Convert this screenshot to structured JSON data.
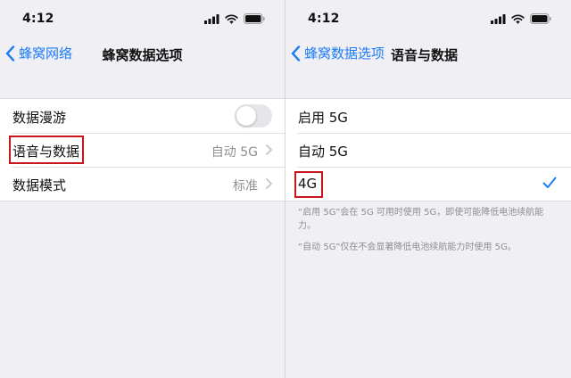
{
  "status": {
    "time": "4:12"
  },
  "left": {
    "back_label": "蜂窝网络",
    "title": "蜂窝数据选项",
    "rows": [
      {
        "label": "数据漫游",
        "toggle_on": false
      },
      {
        "label": "语音与数据",
        "value": "自动 5G"
      },
      {
        "label": "数据模式",
        "value": "标准"
      }
    ]
  },
  "right": {
    "back_label": "蜂窝数据选项",
    "title": "语音与数据",
    "options": [
      {
        "label": "启用 5G",
        "selected": false
      },
      {
        "label": "自动 5G",
        "selected": false
      },
      {
        "label": "4G",
        "selected": true
      }
    ],
    "footnotes": [
      "“启用 5G”会在 5G 可用时使用 5G，即使可能降低电池续航能力。",
      "“自动 5G”仅在不会显著降低电池续航能力时使用 5G。"
    ]
  },
  "colors": {
    "accent": "#1f7cf6",
    "highlight": "#c8161d",
    "background": "#efeff4"
  },
  "icons": [
    "signal-icon",
    "wifi-icon",
    "battery-icon",
    "chevron-left-icon",
    "chevron-right-icon",
    "checkmark-icon"
  ]
}
